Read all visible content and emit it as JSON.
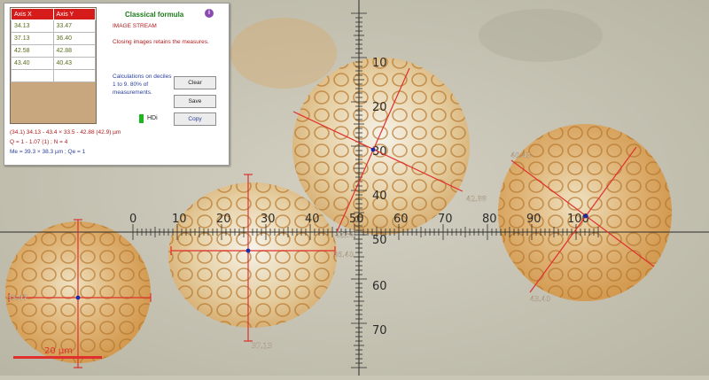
{
  "panel": {
    "title": "Classical formula",
    "stream_label": "IMAGE STREAM",
    "closing_note": "Closing images retains the measures.",
    "calc_note": "Calculations on deciles 1 to 9. 80% of measurements.",
    "buttons": {
      "clear": "Clear",
      "save": "Save",
      "copy": "Copy"
    },
    "hdi_label": "HDi",
    "hdi_color": "#1fb51f",
    "table": {
      "headers": [
        "Axis X",
        "Axis Y"
      ],
      "rows": [
        [
          "34.13",
          "33.47"
        ],
        [
          "37.13",
          "36.40"
        ],
        [
          "42.58",
          "42.88"
        ],
        [
          "43.40",
          "40.43"
        ],
        [
          "",
          ""
        ]
      ]
    },
    "stats": {
      "line1": "(34.1) 34.13 - 43.4 × 33.5 - 42.88 (42.9) µm",
      "line2": "Q = 1 - 1.07 (1) ; N = 4",
      "line3": "Me = 39.3 × 38.3 µm ; Qe = 1"
    }
  },
  "ruler": {
    "h_labels": [
      "0",
      "10",
      "20",
      "30",
      "40",
      "50",
      "60",
      "70",
      "80",
      "90",
      "100"
    ],
    "v_labels": [
      "10",
      "20",
      "30",
      "40",
      "50",
      "60",
      "70"
    ]
  },
  "measure_labels": {
    "grain1_x": "33.47",
    "grain1_y": "37.13",
    "grain2_x": "36.40",
    "grain3_x": "42.58",
    "grain3_y": "42.88",
    "grain4_x": "40.43",
    "grain4_y": "43.40"
  },
  "scale_bar": "20 µm",
  "colors": {
    "measure": "#e0302e",
    "ruler": "#2b2b2b",
    "accent": "#d61b1b"
  }
}
